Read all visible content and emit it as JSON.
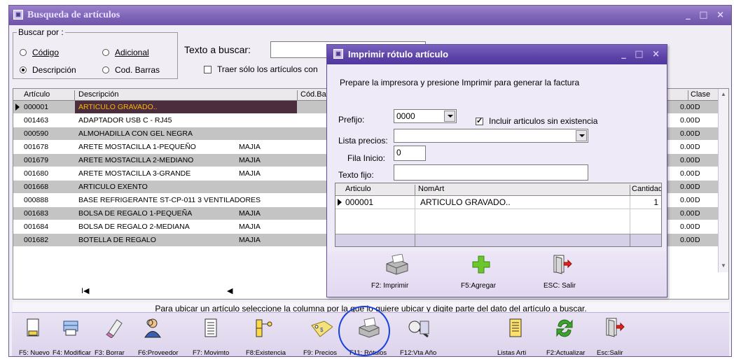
{
  "main_window": {
    "title": "Busqueda de artículos",
    "controls": "_ □ ×"
  },
  "search": {
    "group_label": "Buscar por :",
    "options": {
      "codigo": "Código",
      "adicional": "Adicional",
      "descripcion": "Descripción",
      "cod_barras": "Cod. Barras"
    },
    "selected": "Descripción",
    "text_label": "Texto a buscar:",
    "text_value": "",
    "only_with_stock_label": "Traer sólo los artículos con",
    "only_with_stock_checked": false
  },
  "grid": {
    "headers": {
      "articulo": "Artículo",
      "descripcion": "Descripción",
      "cod_barra": "Cód.Barr",
      "clase": "Clase"
    },
    "rows": [
      {
        "code": "000001",
        "desc": "ARTICULO GRAVADO..",
        "brand": "",
        "price": "0.00",
        "clase": "D"
      },
      {
        "code": "001463",
        "desc": "ADAPTADOR USB C - RJ45",
        "brand": "",
        "price": "0.00",
        "clase": "D"
      },
      {
        "code": "000590",
        "desc": "ALMOHADILLA CON GEL NEGRA",
        "brand": "",
        "price": "0.00",
        "clase": "D"
      },
      {
        "code": "001678",
        "desc": "ARETE MOSTACILLA 1-PEQUEÑO",
        "brand": "MAJIA",
        "price": "0.00",
        "clase": "D"
      },
      {
        "code": "001679",
        "desc": "ARETE MOSTACILLA 2-MEDIANO",
        "brand": "MAJIA",
        "price": "0.00",
        "clase": "D"
      },
      {
        "code": "001680",
        "desc": "ARETE MOSTACILLA 3-GRANDE",
        "brand": "MAJIA",
        "price": "0.00",
        "clase": "D"
      },
      {
        "code": "001668",
        "desc": "ARTICULO EXENTO",
        "brand": "",
        "price": "0.00",
        "clase": "D"
      },
      {
        "code": "000888",
        "desc": "BASE REFRIGERANTE ST-CP-011 3 VENTILADORES",
        "brand": "",
        "price": "0.00",
        "clase": "D"
      },
      {
        "code": "001683",
        "desc": "BOLSA DE REGALO 1-PEQUEÑA",
        "brand": "MAJIA",
        "price": "0.00",
        "clase": "D"
      },
      {
        "code": "001684",
        "desc": "BOLSA DE REGALO 2-MEDIANA",
        "brand": "MAJIA",
        "price": "0.00",
        "clase": "D"
      },
      {
        "code": "001682",
        "desc": "BOTELLA DE REGALO",
        "brand": "MAJIA",
        "price": "0.00",
        "clase": "D"
      }
    ],
    "nav_first": "I◀",
    "nav_prev": "◀"
  },
  "status_text": "Para ubicar un artículo seleccione la columna por la que lo quiere ubicar y digite parte del dato del artículo a buscar.",
  "toolbar": [
    {
      "label": "F5: Nuevo",
      "icon": "new-document-icon"
    },
    {
      "label": "F4: Modificar",
      "icon": "printer-edit-icon"
    },
    {
      "label": "F3: Borrar",
      "icon": "eraser-icon"
    },
    {
      "label": "F6:Proveedor",
      "icon": "supplier-person-icon"
    },
    {
      "label": "F7: Movimto",
      "icon": "ledger-icon"
    },
    {
      "label": "F8:Existencia",
      "icon": "stock-key-icon"
    },
    {
      "label": "F9: Precios",
      "icon": "price-tag-icon"
    },
    {
      "label": "F11: Rótulos",
      "icon": "label-printer-icon"
    },
    {
      "label": "F12:Vta Año",
      "icon": "yearly-sales-icon"
    },
    {
      "label": "Listas Arti",
      "icon": "list-icon"
    },
    {
      "label": "F2:Actualizar",
      "icon": "refresh-icon"
    },
    {
      "label": "Esc:Salir",
      "icon": "exit-door-icon"
    }
  ],
  "dialog": {
    "title": "Imprimir rótulo artículo",
    "controls": "_ □ ×",
    "instruction": "Prepare la impresora y presione Imprimir para generar la factura",
    "prefijo_label": "Prefijo:",
    "prefijo_value": "0000",
    "incluir_label": "Incluir articulos sin existencia",
    "incluir_checked": true,
    "lista_precios_label": "Lista precios:",
    "lista_precios_value": "",
    "fila_inicio_label": "Fila Inicio:",
    "fila_inicio_value": "0",
    "texto_fijo_label": "Texto fijo:",
    "texto_fijo_value": "",
    "grid": {
      "headers": {
        "articulo": "Articulo",
        "nomart": "NomArt",
        "cantidad": "Cantidad"
      },
      "rows": [
        {
          "articulo": "000001",
          "nomart": "ARTICULO GRAVADO..",
          "cantidad": "1"
        }
      ]
    },
    "buttons": {
      "imprimir": "F2: Imprimir",
      "agregar": "F5:Agregar",
      "salir": "ESC: Salir"
    }
  }
}
